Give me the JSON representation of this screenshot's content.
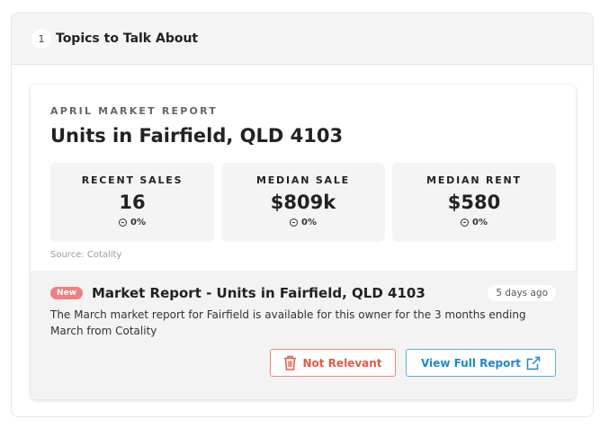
{
  "section": {
    "step": "1",
    "title": "Topics to Talk About"
  },
  "report": {
    "label": "APRIL MARKET REPORT",
    "title": "Units in Fairfield, QLD 4103",
    "stats": [
      {
        "label": "RECENT SALES",
        "value": "16",
        "change": "0%"
      },
      {
        "label": "MEDIAN SALE",
        "value": "$809k",
        "change": "0%"
      },
      {
        "label": "MEDIAN RENT",
        "value": "$580",
        "change": "0%"
      }
    ],
    "source": "Source: Cotality"
  },
  "notice": {
    "badge": "New",
    "title": "Market Report - Units in Fairfield, QLD 4103",
    "time": "5 days ago",
    "description": "The March market report for Fairfield is available for this owner for the 3 months ending March from Cotality",
    "not_relevant_label": "Not Relevant",
    "view_full_label": "View Full Report"
  },
  "colors": {
    "new_badge": "#ee8080",
    "not_relevant": "#e05a45",
    "view_full": "#1f88c7"
  },
  "icons": {
    "trash": "trash-icon",
    "external_link": "external-link-icon",
    "change": "minus-circle-icon"
  }
}
